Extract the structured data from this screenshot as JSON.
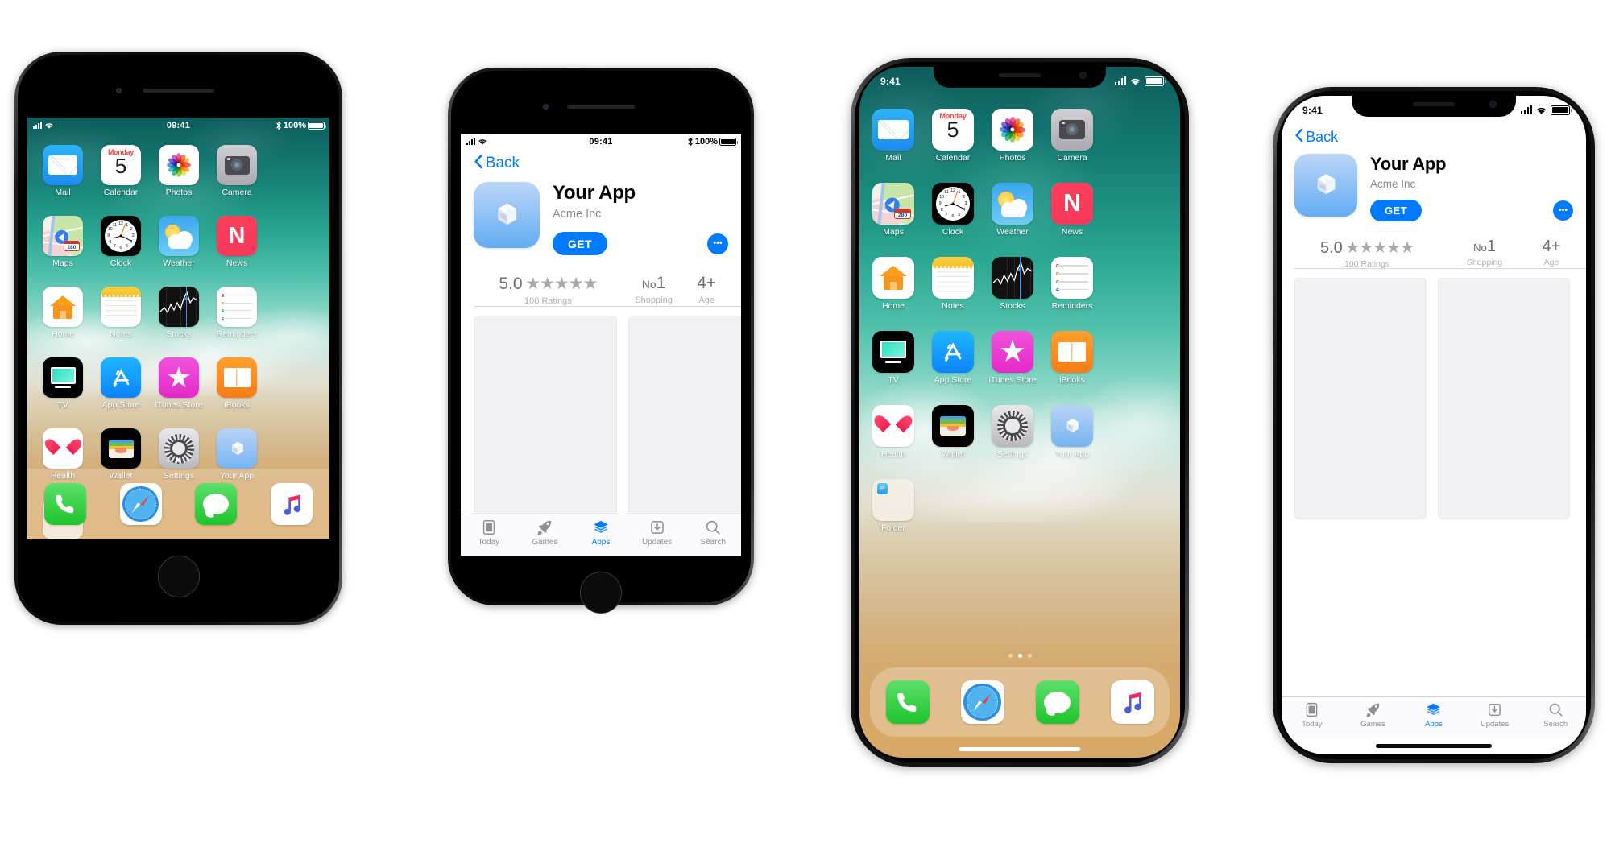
{
  "meta": {
    "accent_blue": "#007aff",
    "tab_inactive": "#8e8e93",
    "star_gray": "#a8a8ad"
  },
  "devices": [
    {
      "name": "iphone-8-home-screen",
      "model": "iPhone 8",
      "screen": "home-screen"
    },
    {
      "name": "iphone-8-app-store",
      "model": "iPhone 8",
      "screen": "app-store"
    },
    {
      "name": "iphone-x-home-screen",
      "model": "iPhone X",
      "screen": "home-screen"
    },
    {
      "name": "iphone-x-app-store",
      "model": "iPhone X",
      "screen": "app-store"
    }
  ],
  "status_bar_8": {
    "time": "09:41",
    "battery_percent": "100%",
    "signal_icon": "cellular-signal-icon",
    "wifi_icon": "wifi-icon",
    "bluetooth_icon": "bluetooth-icon",
    "battery_icon": "battery-icon"
  },
  "status_bar_x": {
    "time": "9:41",
    "signal_icon": "cellular-signal-icon",
    "wifi_icon": "wifi-icon",
    "battery_icon": "battery-icon"
  },
  "home_screen": {
    "calendar": {
      "weekday": "Monday",
      "day": "5"
    },
    "maps": {
      "route_shield": "280"
    },
    "news": {
      "glyph": "N"
    },
    "itunes": {
      "glyph": "★"
    },
    "apps": [
      {
        "label": "Mail",
        "icon": "mail-icon"
      },
      {
        "label": "Calendar",
        "icon": "calendar-icon"
      },
      {
        "label": "Photos",
        "icon": "photos-icon"
      },
      {
        "label": "Camera",
        "icon": "camera-icon"
      },
      {
        "label": "Maps",
        "icon": "maps-icon"
      },
      {
        "label": "Clock",
        "icon": "clock-icon"
      },
      {
        "label": "Weather",
        "icon": "weather-icon"
      },
      {
        "label": "News",
        "icon": "news-icon"
      },
      {
        "label": "Home",
        "icon": "home-icon"
      },
      {
        "label": "Notes",
        "icon": "notes-icon"
      },
      {
        "label": "Stocks",
        "icon": "stocks-icon"
      },
      {
        "label": "Reminders",
        "icon": "reminders-icon"
      },
      {
        "label": "TV",
        "icon": "tv-icon"
      },
      {
        "label": "App Store",
        "icon": "app-store-icon"
      },
      {
        "label": "iTunes Store",
        "icon": "itunes-store-icon"
      },
      {
        "label": "iBooks",
        "icon": "ibooks-icon"
      },
      {
        "label": "Health",
        "icon": "health-icon"
      },
      {
        "label": "Wallet",
        "icon": "wallet-icon"
      },
      {
        "label": "Settings",
        "icon": "settings-icon"
      },
      {
        "label": "Your App",
        "icon": "your-app-icon"
      },
      {
        "label": "Folder",
        "icon": "folder-icon"
      }
    ],
    "dock": [
      {
        "label": "Phone",
        "icon": "phone-icon"
      },
      {
        "label": "Safari",
        "icon": "safari-icon"
      },
      {
        "label": "Messages",
        "icon": "messages-icon"
      },
      {
        "label": "Music",
        "icon": "music-icon"
      }
    ],
    "page_dots": {
      "count": 3,
      "active_index": 1
    }
  },
  "app_store": {
    "back_label": "Back",
    "app_name": "Your App",
    "developer": "Acme Inc",
    "get_label": "GET",
    "more_label": "•••",
    "stats": [
      {
        "value": "5.0",
        "stars": "★★★★★",
        "sub": "100 Ratings",
        "name": "rating"
      },
      {
        "value": "No1",
        "stars": "",
        "sub": "Shopping",
        "name": "rank"
      },
      {
        "value": "4+",
        "stars": "",
        "sub": "Age",
        "name": "age"
      }
    ],
    "screenshot_count": 2,
    "tabs": [
      {
        "label": "Today",
        "icon": "today-icon",
        "active": false
      },
      {
        "label": "Games",
        "icon": "games-icon",
        "active": false
      },
      {
        "label": "Apps",
        "icon": "apps-icon",
        "active": true
      },
      {
        "label": "Updates",
        "icon": "updates-icon",
        "active": false
      },
      {
        "label": "Search",
        "icon": "search-icon",
        "active": false
      }
    ]
  }
}
